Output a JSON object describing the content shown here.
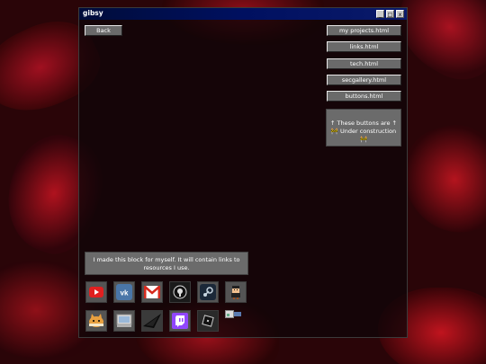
{
  "window": {
    "title": "gibsy"
  },
  "controls": {
    "minimize": "_",
    "maximize": "□",
    "close": "x"
  },
  "nav": {
    "back_label": "Back"
  },
  "links": [
    "my projects.html",
    "links.html",
    "tech.html",
    "secgallery.html",
    "buttons.html"
  ],
  "notice": {
    "line1": "↑ These buttons are ↑",
    "line2": "🚧 Under construction 🚧"
  },
  "info": {
    "text": "I made this block for myself. It will contain links to resources I use."
  },
  "icons": [
    "youtube-icon",
    "vk-icon",
    "gmail-icon",
    "github-icon",
    "steam-icon",
    "pixel-character-icon",
    "cat-sticker-icon",
    "drive-icon",
    "shard-icon",
    "twitch-icon",
    "roblox-icon",
    "broken-image-icon"
  ],
  "colors": {
    "titlebar": "#001060",
    "button": "#6a6a6a",
    "panel": "#6b6b6b"
  }
}
